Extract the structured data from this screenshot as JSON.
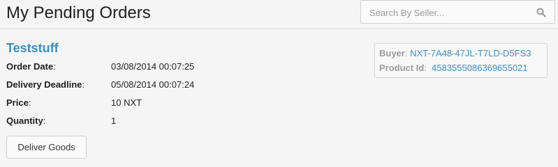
{
  "header": {
    "title": "My Pending Orders",
    "search": {
      "placeholder": "Search By Seller...",
      "value": "",
      "icon": "search-icon"
    }
  },
  "order": {
    "title": "Teststuff",
    "fields": [
      {
        "label": "Order Date",
        "value": "03/08/2014 00:07:25"
      },
      {
        "label": "Delivery Deadline",
        "value": "05/08/2014 00:07:24"
      },
      {
        "label": "Price",
        "value": "10 NXT"
      },
      {
        "label": "Quantity",
        "value": "1"
      }
    ],
    "deliver_button": "Deliver Goods",
    "buyer": {
      "label": "Buyer",
      "value": "NXT-7A48-47JL-T7LD-D5FS3"
    },
    "product": {
      "label": "Product Id",
      "value": "4583555086369655021"
    }
  },
  "colors": {
    "link": "#3b8fc2",
    "muted_label": "#9a9a9a",
    "background": "#f5f5f5"
  }
}
